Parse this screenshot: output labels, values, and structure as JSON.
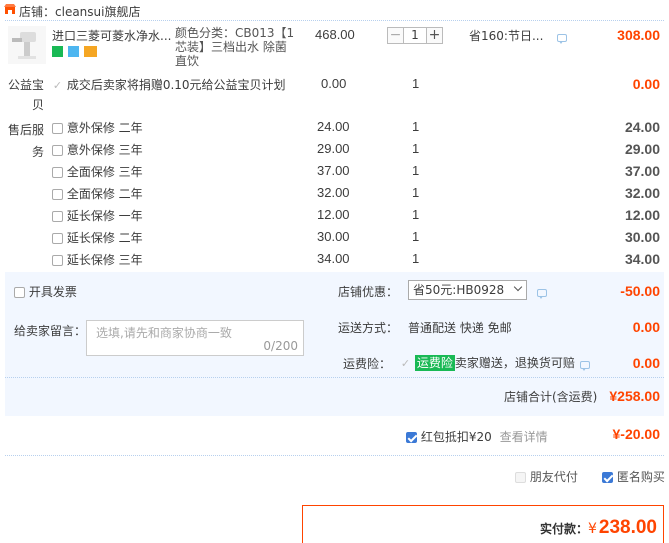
{
  "shop": {
    "label": "店铺：",
    "name": "cleansui旗舰店"
  },
  "item": {
    "title": "进口三菱可菱水净水...",
    "sku": "颜色分类：CB013【1芯装】三档出水 除菌直饮",
    "sku_line1": "颜色分类：CB013【1",
    "sku_line2": "芯装】三档出水 除菌",
    "sku_line3": "直饮",
    "unit_price": "468.00",
    "qty": "1",
    "promo": "省160:节日...",
    "subtotal": "308.00"
  },
  "charity": {
    "label_line1": "公益宝",
    "label_line2": "贝",
    "text": "成交后卖家将捐赠0.10元给公益宝贝计划",
    "price": "0.00",
    "qty": "1",
    "subtotal": "0.00"
  },
  "service": {
    "label_line1": "售后服",
    "label_line2": "务",
    "options": [
      {
        "name": "意外保修 二年",
        "price": "24.00",
        "qty": "1",
        "subtotal": "24.00"
      },
      {
        "name": "意外保修 三年",
        "price": "29.00",
        "qty": "1",
        "subtotal": "29.00"
      },
      {
        "name": "全面保修 三年",
        "price": "37.00",
        "qty": "1",
        "subtotal": "37.00"
      },
      {
        "name": "全面保修 二年",
        "price": "32.00",
        "qty": "1",
        "subtotal": "32.00"
      },
      {
        "name": "延长保修 一年",
        "price": "12.00",
        "qty": "1",
        "subtotal": "12.00"
      },
      {
        "name": "延长保修 二年",
        "price": "30.00",
        "qty": "1",
        "subtotal": "30.00"
      },
      {
        "name": "延长保修 三年",
        "price": "34.00",
        "qty": "1",
        "subtotal": "34.00"
      }
    ]
  },
  "invoice": {
    "label": "开具发票"
  },
  "message": {
    "label": "给卖家留言：",
    "placeholder": "选填,请先和商家协商一致",
    "counter": "0/200"
  },
  "discount": {
    "label": "店铺优惠：",
    "selected": "省50元:HB0928",
    "amount": "-50.00"
  },
  "shipping": {
    "label": "运送方式：",
    "method": "普通配送 快递 免邮",
    "amount": "0.00"
  },
  "insurance": {
    "label": "运费险：",
    "badge": "运费险",
    "text": "卖家赠送，退换货可赔",
    "amount": "0.00"
  },
  "shop_total": {
    "label": "店铺合计(含运费)",
    "amount": "¥258.00"
  },
  "redpacket": {
    "label": "红包抵扣¥20",
    "link": "查看详情",
    "amount": "¥-20.00"
  },
  "options": {
    "friend_pay": "朋友代付",
    "anonymous": "匿名购买"
  },
  "payment": {
    "label": "实付款：",
    "currency": "¥",
    "amount": "238.00"
  },
  "colors": {
    "accent": "#f40",
    "panel": "#f2f7ff",
    "link": "#3b79d6"
  }
}
